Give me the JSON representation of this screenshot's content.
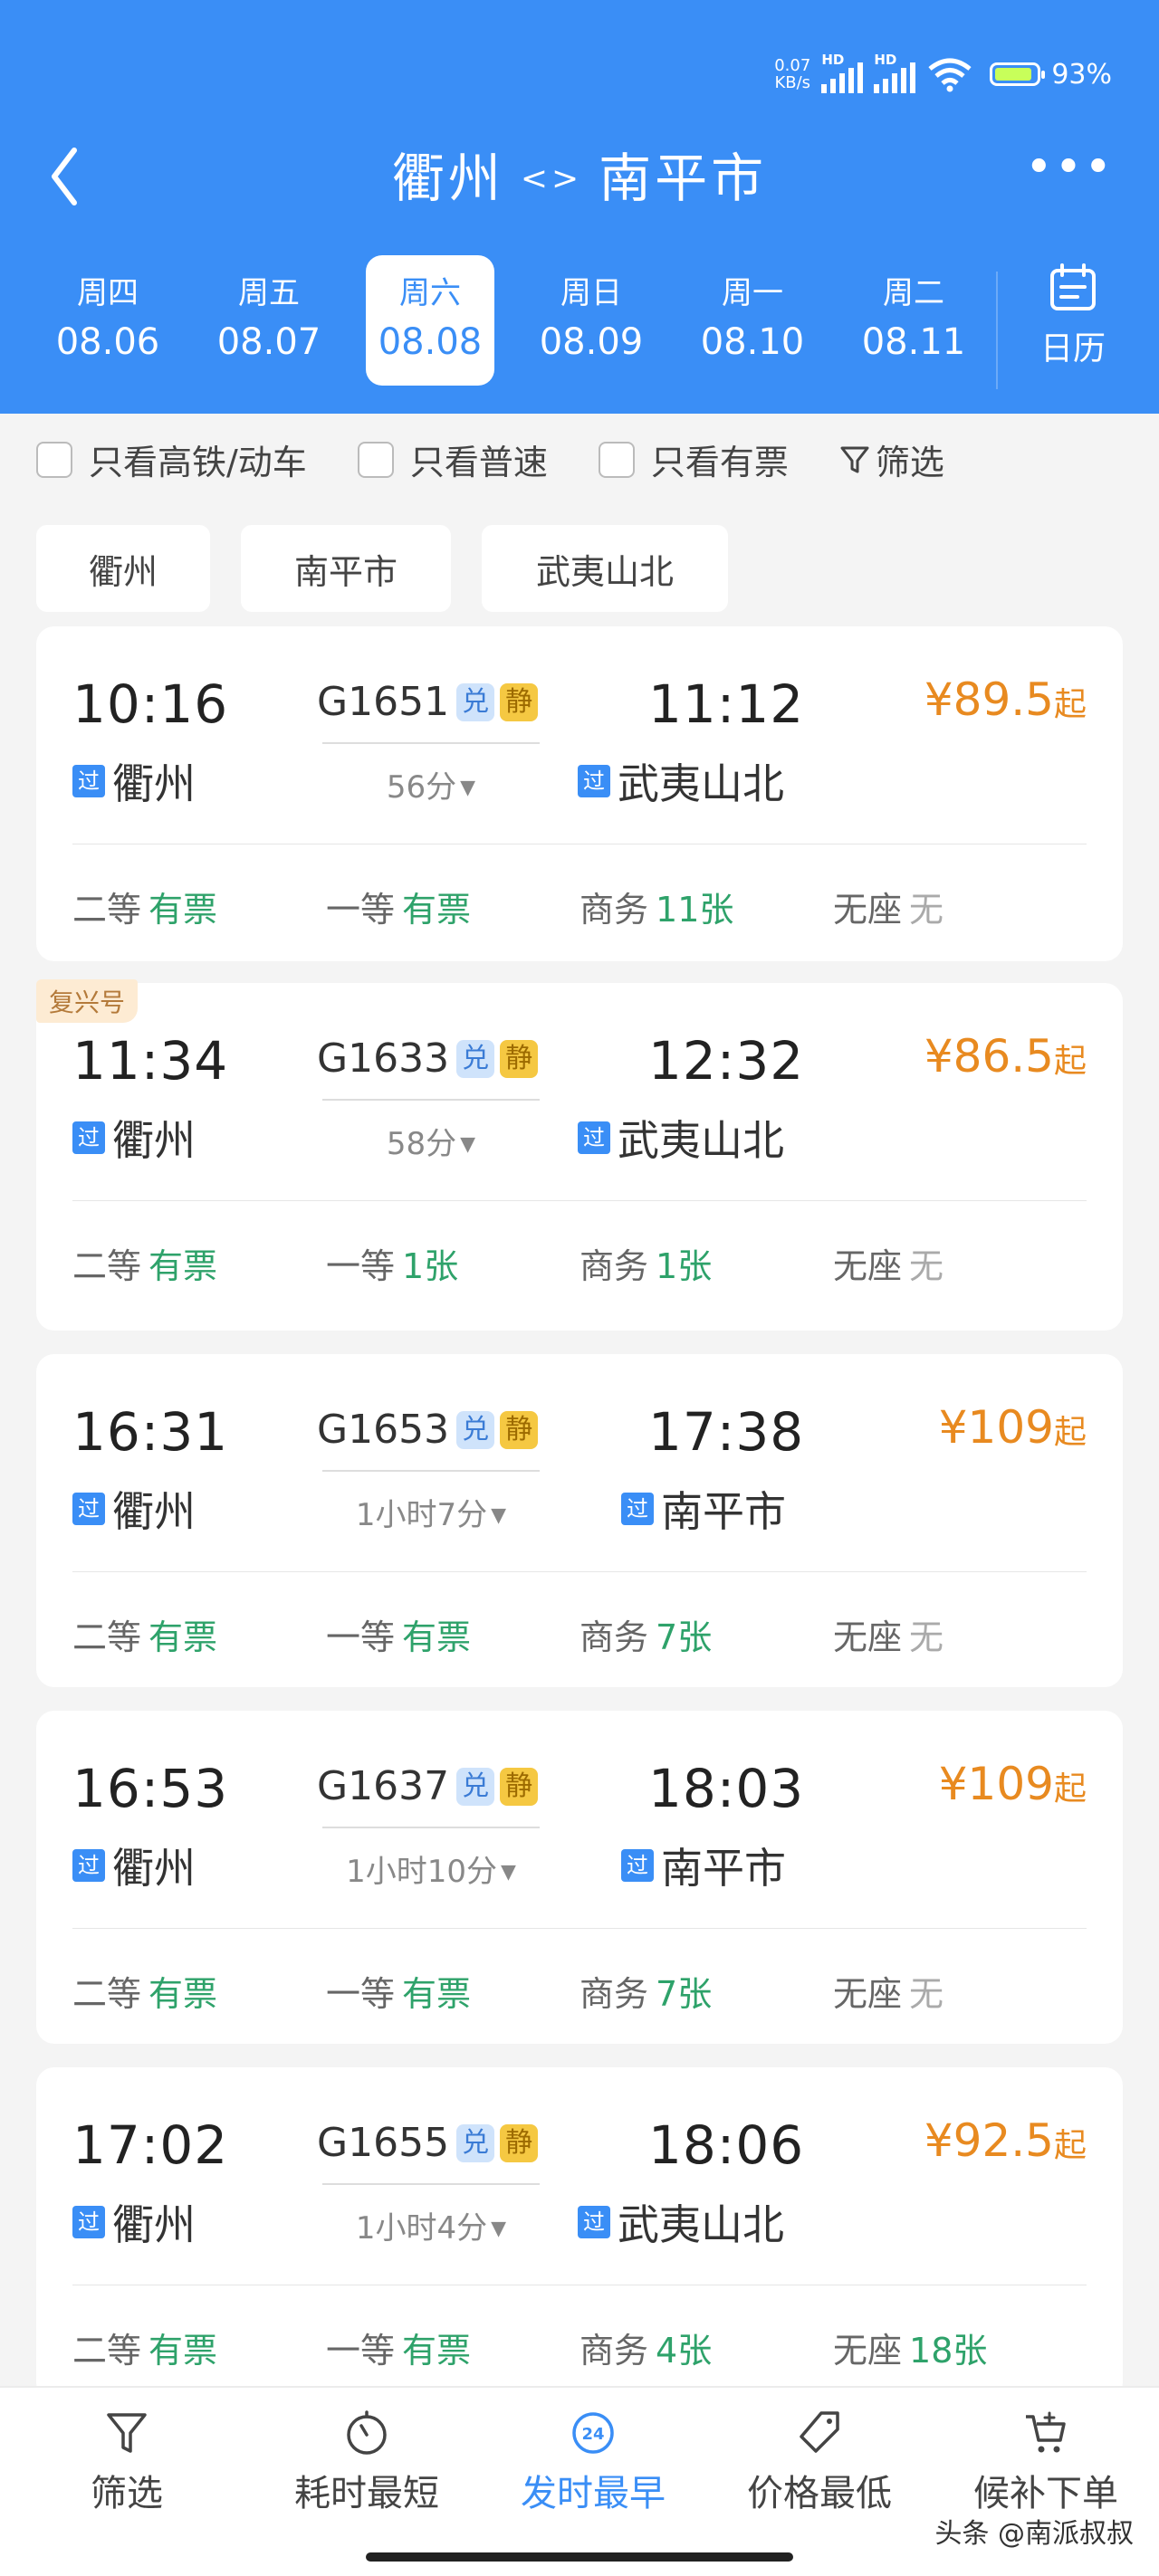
{
  "status_bar": {
    "net_speed": "0.07",
    "net_unit": "KB/s",
    "hd1": "HD",
    "hd2": "HD",
    "battery": "93%"
  },
  "header": {
    "from": "衢州",
    "swap": "<>",
    "to": "南平市"
  },
  "dates": [
    {
      "weekday": "周四",
      "date": "08.06"
    },
    {
      "weekday": "周五",
      "date": "08.07"
    },
    {
      "weekday": "周六",
      "date": "08.08"
    },
    {
      "weekday": "周日",
      "date": "08.09"
    },
    {
      "weekday": "周一",
      "date": "08.10"
    },
    {
      "weekday": "周二",
      "date": "08.11"
    }
  ],
  "calendar_label": "日历",
  "filters": {
    "high_speed": "只看高铁/动车",
    "normal": "只看普速",
    "available": "只看有票",
    "filter": "筛选"
  },
  "stations": [
    "衢州",
    "南平市",
    "武夷山北"
  ],
  "trains": [
    {
      "tag": "",
      "dep_time": "10:16",
      "train_no": "G1651",
      "b1": "兑",
      "b2": "静",
      "arr_time": "11:12",
      "price": "¥89.5",
      "price_suffix": "起",
      "duration": "56分",
      "from": "衢州",
      "to": "武夷山北",
      "guo": "过",
      "seats": [
        {
          "name": "二等",
          "value": "有票"
        },
        {
          "name": "一等",
          "value": "有票"
        },
        {
          "name": "商务",
          "value": "11张"
        },
        {
          "name": "无座",
          "value": "无"
        }
      ]
    },
    {
      "tag": "复兴号",
      "dep_time": "11:34",
      "train_no": "G1633",
      "b1": "兑",
      "b2": "静",
      "arr_time": "12:32",
      "price": "¥86.5",
      "price_suffix": "起",
      "duration": "58分",
      "from": "衢州",
      "to": "武夷山北",
      "guo": "过",
      "seats": [
        {
          "name": "二等",
          "value": "有票"
        },
        {
          "name": "一等",
          "value": "1张"
        },
        {
          "name": "商务",
          "value": "1张"
        },
        {
          "name": "无座",
          "value": "无"
        }
      ]
    },
    {
      "tag": "",
      "dep_time": "16:31",
      "train_no": "G1653",
      "b1": "兑",
      "b2": "静",
      "arr_time": "17:38",
      "price": "¥109",
      "price_suffix": "起",
      "duration": "1小时7分",
      "from": "衢州",
      "to": "南平市",
      "guo": "过",
      "seats": [
        {
          "name": "二等",
          "value": "有票"
        },
        {
          "name": "一等",
          "value": "有票"
        },
        {
          "name": "商务",
          "value": "7张"
        },
        {
          "name": "无座",
          "value": "无"
        }
      ]
    },
    {
      "tag": "",
      "dep_time": "16:53",
      "train_no": "G1637",
      "b1": "兑",
      "b2": "静",
      "arr_time": "18:03",
      "price": "¥109",
      "price_suffix": "起",
      "duration": "1小时10分",
      "from": "衢州",
      "to": "南平市",
      "guo": "过",
      "seats": [
        {
          "name": "二等",
          "value": "有票"
        },
        {
          "name": "一等",
          "value": "有票"
        },
        {
          "name": "商务",
          "value": "7张"
        },
        {
          "name": "无座",
          "value": "无"
        }
      ]
    },
    {
      "tag": "",
      "dep_time": "17:02",
      "train_no": "G1655",
      "b1": "兑",
      "b2": "静",
      "arr_time": "18:06",
      "price": "¥92.5",
      "price_suffix": "起",
      "duration": "1小时4分",
      "from": "衢州",
      "to": "武夷山北",
      "guo": "过",
      "seats": [
        {
          "name": "二等",
          "value": "有票"
        },
        {
          "name": "一等",
          "value": "有票"
        },
        {
          "name": "商务",
          "value": "4张"
        },
        {
          "name": "无座",
          "value": "18张"
        }
      ]
    }
  ],
  "bottom_tabs": [
    "筛选",
    "耗时最短",
    "发时最早",
    "价格最低",
    "候补下单"
  ],
  "clock_badge": "24",
  "watermark": "头条 @南派叔叔",
  "colors": {
    "primary": "#3a8ef6",
    "price": "#e88a20",
    "available": "#2ea26a"
  }
}
